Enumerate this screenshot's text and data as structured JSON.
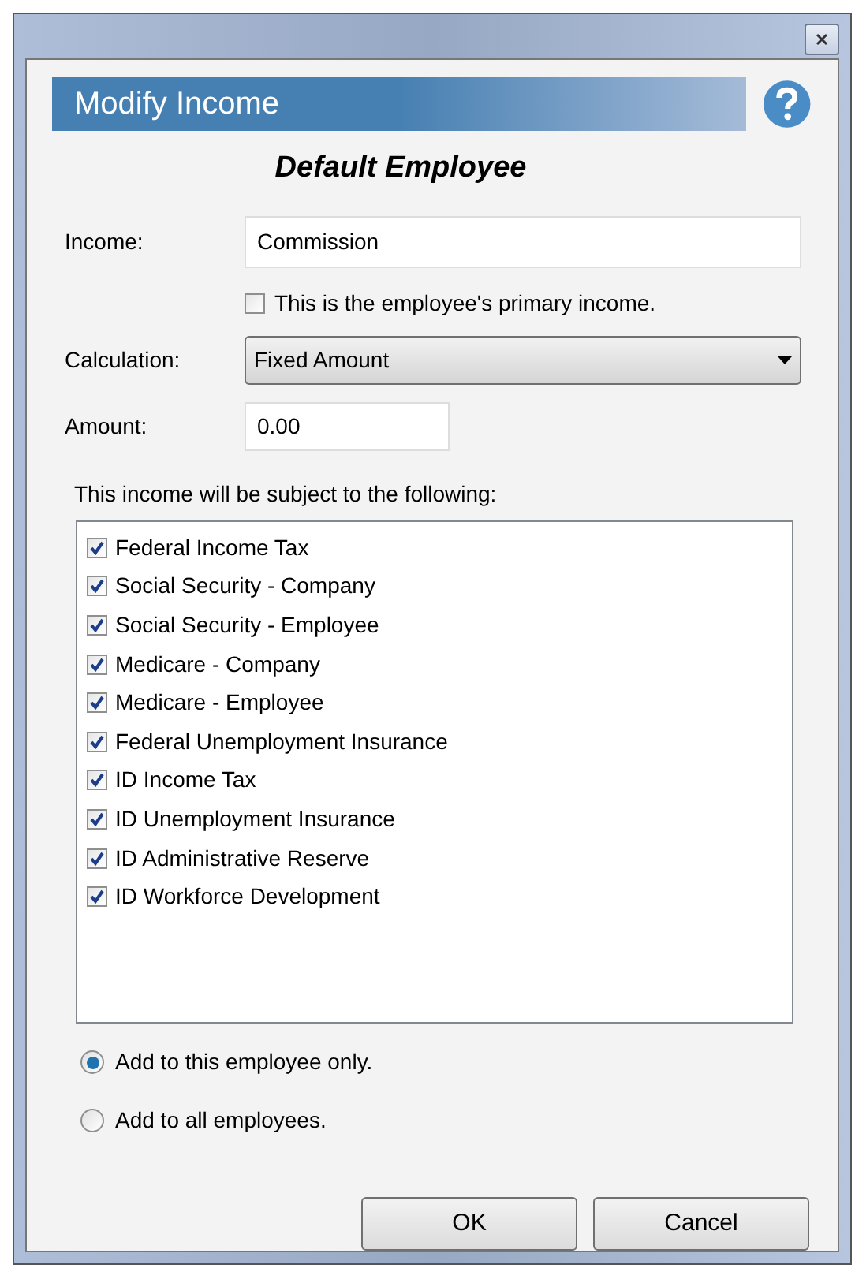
{
  "dialog": {
    "title": "Modify Income",
    "employee": "Default Employee"
  },
  "form": {
    "income_label": "Income:",
    "income_value": "Commission",
    "primary": {
      "label": "This is the employee's primary income.",
      "checked": false
    },
    "calculation_label": "Calculation:",
    "calculation_value": "Fixed Amount",
    "amount_label": "Amount:",
    "amount_value": "0.00"
  },
  "subject_label": "This income will be subject to the following:",
  "taxes": [
    {
      "label": "Federal Income Tax",
      "checked": true
    },
    {
      "label": "Social Security - Company",
      "checked": true
    },
    {
      "label": "Social Security - Employee",
      "checked": true
    },
    {
      "label": "Medicare - Company",
      "checked": true
    },
    {
      "label": "Medicare - Employee",
      "checked": true
    },
    {
      "label": "Federal Unemployment Insurance",
      "checked": true
    },
    {
      "label": "ID Income Tax",
      "checked": true
    },
    {
      "label": "ID Unemployment Insurance",
      "checked": true
    },
    {
      "label": "ID Administrative Reserve",
      "checked": true
    },
    {
      "label": "ID Workforce Development",
      "checked": true
    }
  ],
  "scope": [
    {
      "label": "Add to this employee only.",
      "selected": true
    },
    {
      "label": "Add to all employees.",
      "selected": false
    }
  ],
  "buttons": [
    "OK",
    "Cancel"
  ]
}
